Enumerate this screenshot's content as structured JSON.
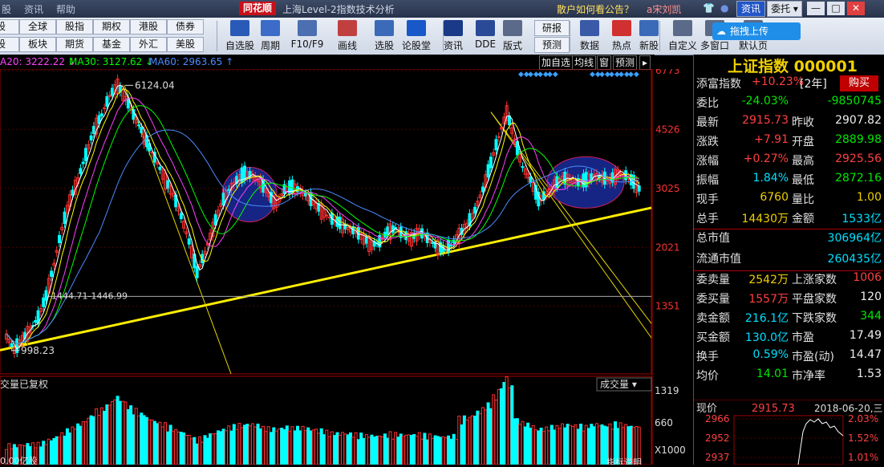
{
  "menu": {
    "items": [
      "股",
      "资讯",
      "帮助"
    ],
    "logo": "同花顺",
    "title": "上海Level-2指数技术分析",
    "ad": "散户如何看公告？",
    "user": "a宋刘凯",
    "tab_zixun": "资讯",
    "tab_weituo": "委托",
    "minimize": "—",
    "restore": "□",
    "close": "✕"
  },
  "quick": [
    [
      "股",
      "全球",
      "股指",
      "期权",
      "港股",
      "债券"
    ],
    [
      "股",
      "板块",
      "期货",
      "基金",
      "外汇",
      "美股"
    ]
  ],
  "tools": [
    {
      "label": "自选股",
      "color": "#2a5ab8"
    },
    {
      "label": "周期",
      "color": "#3c6cc8"
    },
    {
      "label": "F10/F9",
      "color": "#4b6fb0"
    },
    {
      "label": "画线",
      "color": "#c04040"
    },
    {
      "label": "选股",
      "color": "#3a6ab8"
    },
    {
      "label": "论股堂",
      "color": "#1858c8"
    },
    {
      "label": "资讯",
      "color": "#1a3a88"
    },
    {
      "label": "DDE",
      "color": "#2a4a98"
    },
    {
      "label": "版式",
      "color": "#5a6a88"
    },
    {
      "label": "研报",
      "color": "#eef2f8"
    },
    {
      "label": "预测",
      "color": "#eef2f8"
    },
    {
      "label": "数据",
      "color": "#3a5aa8"
    },
    {
      "label": "热点",
      "color": "#d03030"
    },
    {
      "label": "新股",
      "color": "#3a6ab8"
    },
    {
      "label": "自定义",
      "color": "#5a6a88"
    },
    {
      "label": "多窗口",
      "color": "#5a6a88"
    },
    {
      "label": "默认页",
      "color": "#5a6a88"
    }
  ],
  "upload": "拖拽上传",
  "info": {
    "ma20": "A20: 3222.22 ↓",
    "ma30": "MA30: 3127.62 ↓",
    "ma60": "MA60: 2963.65 ↑"
  },
  "chart_buttons": [
    "加自选",
    "均线",
    "窗",
    "预测"
  ],
  "chart_data": {
    "type": "candlestick",
    "y_axis_labels": [
      "6773",
      "4526",
      "3025",
      "2021",
      "1351"
    ],
    "annotations": {
      "high": "6124.04",
      "low": "998.23",
      "line_label": "1444.71-1446.99"
    },
    "price_path": [
      1100,
      1000,
      1080,
      1150,
      1250,
      1450,
      1800,
      2300,
      2800,
      3200,
      3800,
      4500,
      5000,
      5700,
      6124,
      5600,
      5000,
      4500,
      4000,
      3600,
      3200,
      2900,
      2500,
      2100,
      1700,
      1950,
      2300,
      2700,
      3000,
      3200,
      3350,
      3300,
      3150,
      2900,
      2700,
      3000,
      3050,
      2980,
      2850,
      2700,
      2550,
      2450,
      2380,
      2300,
      2250,
      2150,
      2050,
      2100,
      2250,
      2300,
      2200,
      2150,
      2250,
      2150,
      2050,
      2000,
      2050,
      2200,
      2350,
      2600,
      3000,
      3600,
      4300,
      5100,
      4200,
      3500,
      3200,
      2800,
      2900,
      3100,
      3250,
      3200,
      3150,
      3200,
      3300,
      3250,
      3200,
      3350,
      3300,
      3150,
      2950
    ],
    "volume_axis": [
      "1319",
      "660",
      "X1000"
    ],
    "volume_label": "成交量",
    "volume_title": "交量已复权",
    "volume_footer": "0.00亿股",
    "footer_right": "指标说明"
  },
  "quote": {
    "name": "上证指数",
    "code": "000001",
    "change_text": "+10.23%",
    "change_period": "[2年]",
    "buy": "购买",
    "tianfu": "添富指数",
    "rows": [
      {
        "l1": "委比",
        "v1": "-24.03%",
        "c1": "green",
        "l2": "",
        "v2": "-9850745",
        "c2": "green"
      },
      {
        "l1": "最新",
        "v1": "2915.73",
        "c1": "red",
        "l2": "昨收",
        "v2": "2907.82",
        "c2": "white"
      },
      {
        "l1": "涨跌",
        "v1": "+7.91",
        "c1": "red",
        "l2": "开盘",
        "v2": "2889.98",
        "c2": "green"
      },
      {
        "l1": "涨幅",
        "v1": "+0.27%",
        "c1": "red",
        "l2": "最高",
        "v2": "2925.56",
        "c2": "red"
      },
      {
        "l1": "振幅",
        "v1": "1.84%",
        "c1": "cyan",
        "l2": "最低",
        "v2": "2872.16",
        "c2": "green"
      },
      {
        "l1": "现手",
        "v1": "6760",
        "c1": "yellow",
        "l2": "量比",
        "v2": "1.00",
        "c2": "yellow"
      },
      {
        "l1": "总手",
        "v1": "14430万",
        "c1": "yellow",
        "l2": "金额",
        "v2": "1533亿",
        "c2": "cyan"
      },
      {
        "l1": "总市值",
        "v1": "",
        "c1": "white",
        "l2": "",
        "v2": "306964亿",
        "c2": "cyan"
      },
      {
        "l1": "流通市值",
        "v1": "",
        "c1": "white",
        "l2": "",
        "v2": "260435亿",
        "c2": "cyan"
      },
      {
        "l1": "委卖量",
        "v1": "2542万",
        "c1": "yellow",
        "l2": "上涨家数",
        "v2": "1006",
        "c2": "red"
      },
      {
        "l1": "委买量",
        "v1": "1557万",
        "c1": "red",
        "l2": "平盘家数",
        "v2": "120",
        "c2": "white"
      },
      {
        "l1": "卖金额",
        "v1": "216.1亿",
        "c1": "cyan",
        "l2": "下跌家数",
        "v2": "344",
        "c2": "green"
      },
      {
        "l1": "买金额",
        "v1": "130.0亿",
        "c1": "cyan",
        "l2": "市盈",
        "v2": "17.49",
        "c2": "white"
      },
      {
        "l1": "换手",
        "v1": "0.59%",
        "c1": "cyan",
        "l2": "市盈(动)",
        "v2": "14.47",
        "c2": "white"
      },
      {
        "l1": "均价",
        "v1": "14.01",
        "c1": "green",
        "l2": "市净率",
        "v2": "1.53",
        "c2": "white"
      }
    ],
    "mini": {
      "label": "现价",
      "price": "2915.73",
      "date": "2018-06-20,三",
      "y1": "2966",
      "y2": "2952",
      "y3": "2937",
      "p1": "2.03%",
      "p2": "1.52%",
      "p3": "1.01%"
    }
  },
  "colors": {
    "up": "#ff3030",
    "down": "#00ffff",
    "ma5": "#ffffff",
    "ma10": "#ffff00",
    "ma20": "#ff40ff",
    "ma30": "#00ff00",
    "ma60": "#4a8cff",
    "trend": "#ffee00",
    "circle": "#1a2a9a"
  }
}
